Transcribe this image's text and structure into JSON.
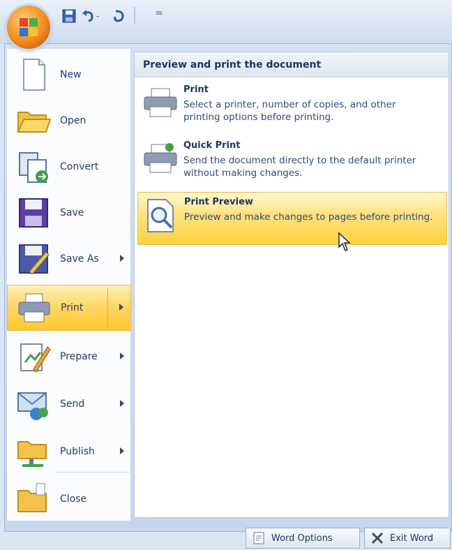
{
  "quick_access": {
    "save_icon": "save-icon",
    "undo_icon": "undo-icon",
    "undo_dropdown": "-",
    "redo_icon": "redo-icon",
    "customize": "="
  },
  "menu_commands": [
    {
      "label": "New",
      "icon": "new-document-icon",
      "submenu": false
    },
    {
      "label": "Open",
      "icon": "open-folder-icon",
      "submenu": false
    },
    {
      "label": "Convert",
      "icon": "convert-icon",
      "submenu": false
    },
    {
      "label": "Save",
      "icon": "save-disk-icon",
      "submenu": false
    },
    {
      "label": "Save As",
      "icon": "save-as-icon",
      "submenu": true
    },
    {
      "label": "Print",
      "icon": "printer-icon",
      "submenu": true,
      "active": true
    },
    {
      "label": "Prepare",
      "icon": "prepare-icon",
      "submenu": true
    },
    {
      "label": "Send",
      "icon": "send-icon",
      "submenu": true
    },
    {
      "label": "Publish",
      "icon": "publish-icon",
      "submenu": true
    },
    {
      "label": "Close",
      "icon": "close-folder-icon",
      "submenu": false
    }
  ],
  "submenu": {
    "header": "Preview and print the document",
    "options": [
      {
        "title": "Print",
        "description": "Select a printer, number of copies, and other printing options before printing.",
        "icon": "printer-icon"
      },
      {
        "title": "Quick Print",
        "description": "Send the document directly to the default printer without making changes.",
        "icon": "quick-print-icon"
      },
      {
        "title": "Print Preview",
        "description": "Preview and make changes to pages before printing.",
        "icon": "print-preview-icon",
        "highlighted": true
      }
    ]
  },
  "footer": {
    "options_label": "Word Options",
    "exit_label": "Exit Word"
  },
  "colors": {
    "highlight": "#ffd35c",
    "menu_bg": "#c6d6ec",
    "text": "#1c3564"
  }
}
